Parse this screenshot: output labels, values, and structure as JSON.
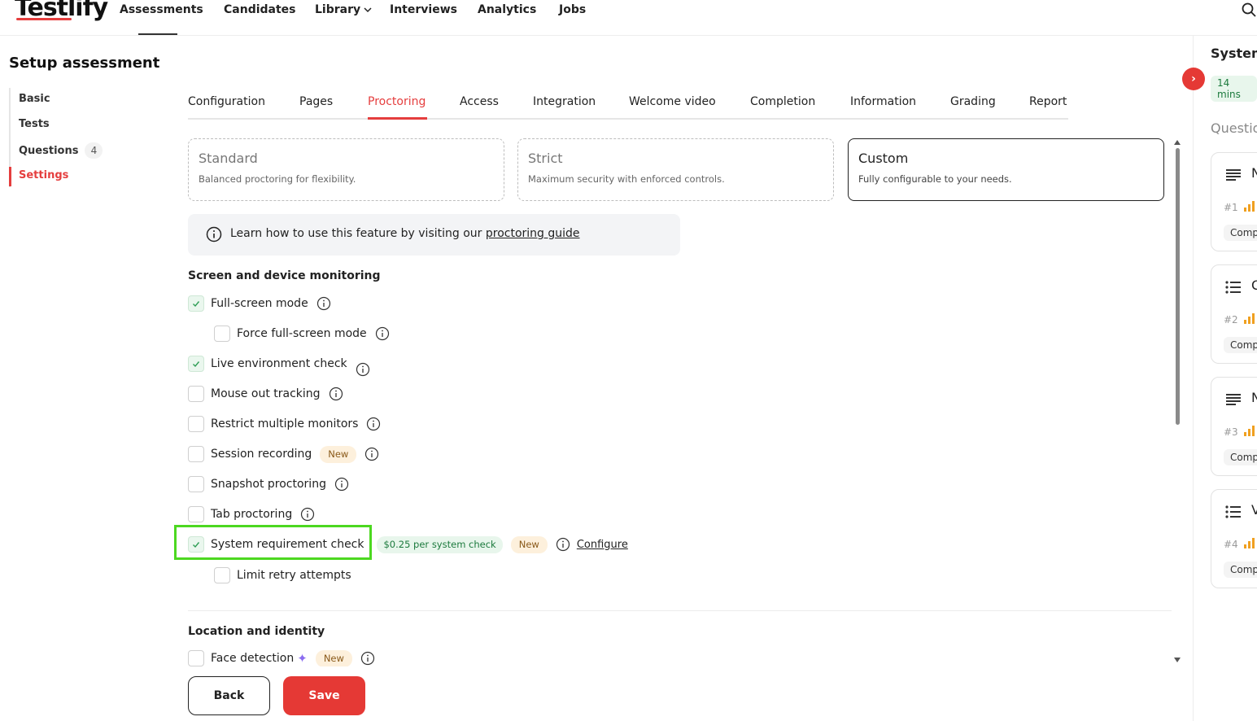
{
  "nav": {
    "logo": "Testlify",
    "items": [
      "Assessments",
      "Candidates",
      "Library",
      "Interviews",
      "Analytics",
      "Jobs"
    ],
    "active": "Assessments"
  },
  "sidebar": {
    "title": "Setup assessment",
    "items": [
      {
        "label": "Basic"
      },
      {
        "label": "Tests"
      },
      {
        "label": "Questions",
        "count": "4"
      },
      {
        "label": "Settings"
      }
    ],
    "active": "Settings"
  },
  "tabs": {
    "items": [
      "Configuration",
      "Pages",
      "Proctoring",
      "Access",
      "Integration",
      "Welcome video",
      "Completion",
      "Information",
      "Grading",
      "Report"
    ],
    "active": "Proctoring"
  },
  "modes": [
    {
      "title": "Standard",
      "desc": "Balanced proctoring for flexibility."
    },
    {
      "title": "Strict",
      "desc": "Maximum security with enforced controls."
    },
    {
      "title": "Custom",
      "desc": "Fully configurable to your needs."
    }
  ],
  "banner": {
    "text": "Learn how to use this feature by visiting our ",
    "link": "proctoring guide"
  },
  "sections": {
    "screen": "Screen and device monitoring",
    "location": "Location and identity"
  },
  "options": {
    "full_screen": "Full-screen mode",
    "force_full_screen": "Force full-screen mode",
    "live_env": "Live environment check",
    "mouse_out": "Mouse out tracking",
    "restrict_monitors": "Restrict multiple monitors",
    "session_recording": "Session recording",
    "snapshot": "Snapshot proctoring",
    "tab_proctoring": "Tab proctoring",
    "system_req": "System requirement check",
    "system_req_price": "$0.25 per system check",
    "configure": "Configure",
    "limit_retry": "Limit retry attempts",
    "face_detection": "Face detection"
  },
  "badges": {
    "new": "New"
  },
  "buttons": {
    "back": "Back",
    "save": "Save"
  },
  "right_panel": {
    "title": "System",
    "duration": "14 mins",
    "subtitle": "Questio",
    "cards": [
      {
        "letter": "N",
        "num": "#1",
        "pill": "Comp"
      },
      {
        "letter": "C",
        "num": "#2",
        "pill": "Comp"
      },
      {
        "letter": "N",
        "num": "#3",
        "pill": "Comp"
      },
      {
        "letter": "V",
        "num": "#4",
        "pill": "Comp"
      }
    ]
  },
  "colors": {
    "accent": "#e53935",
    "highlight": "#4cd820",
    "success": "#1c7a3d"
  }
}
